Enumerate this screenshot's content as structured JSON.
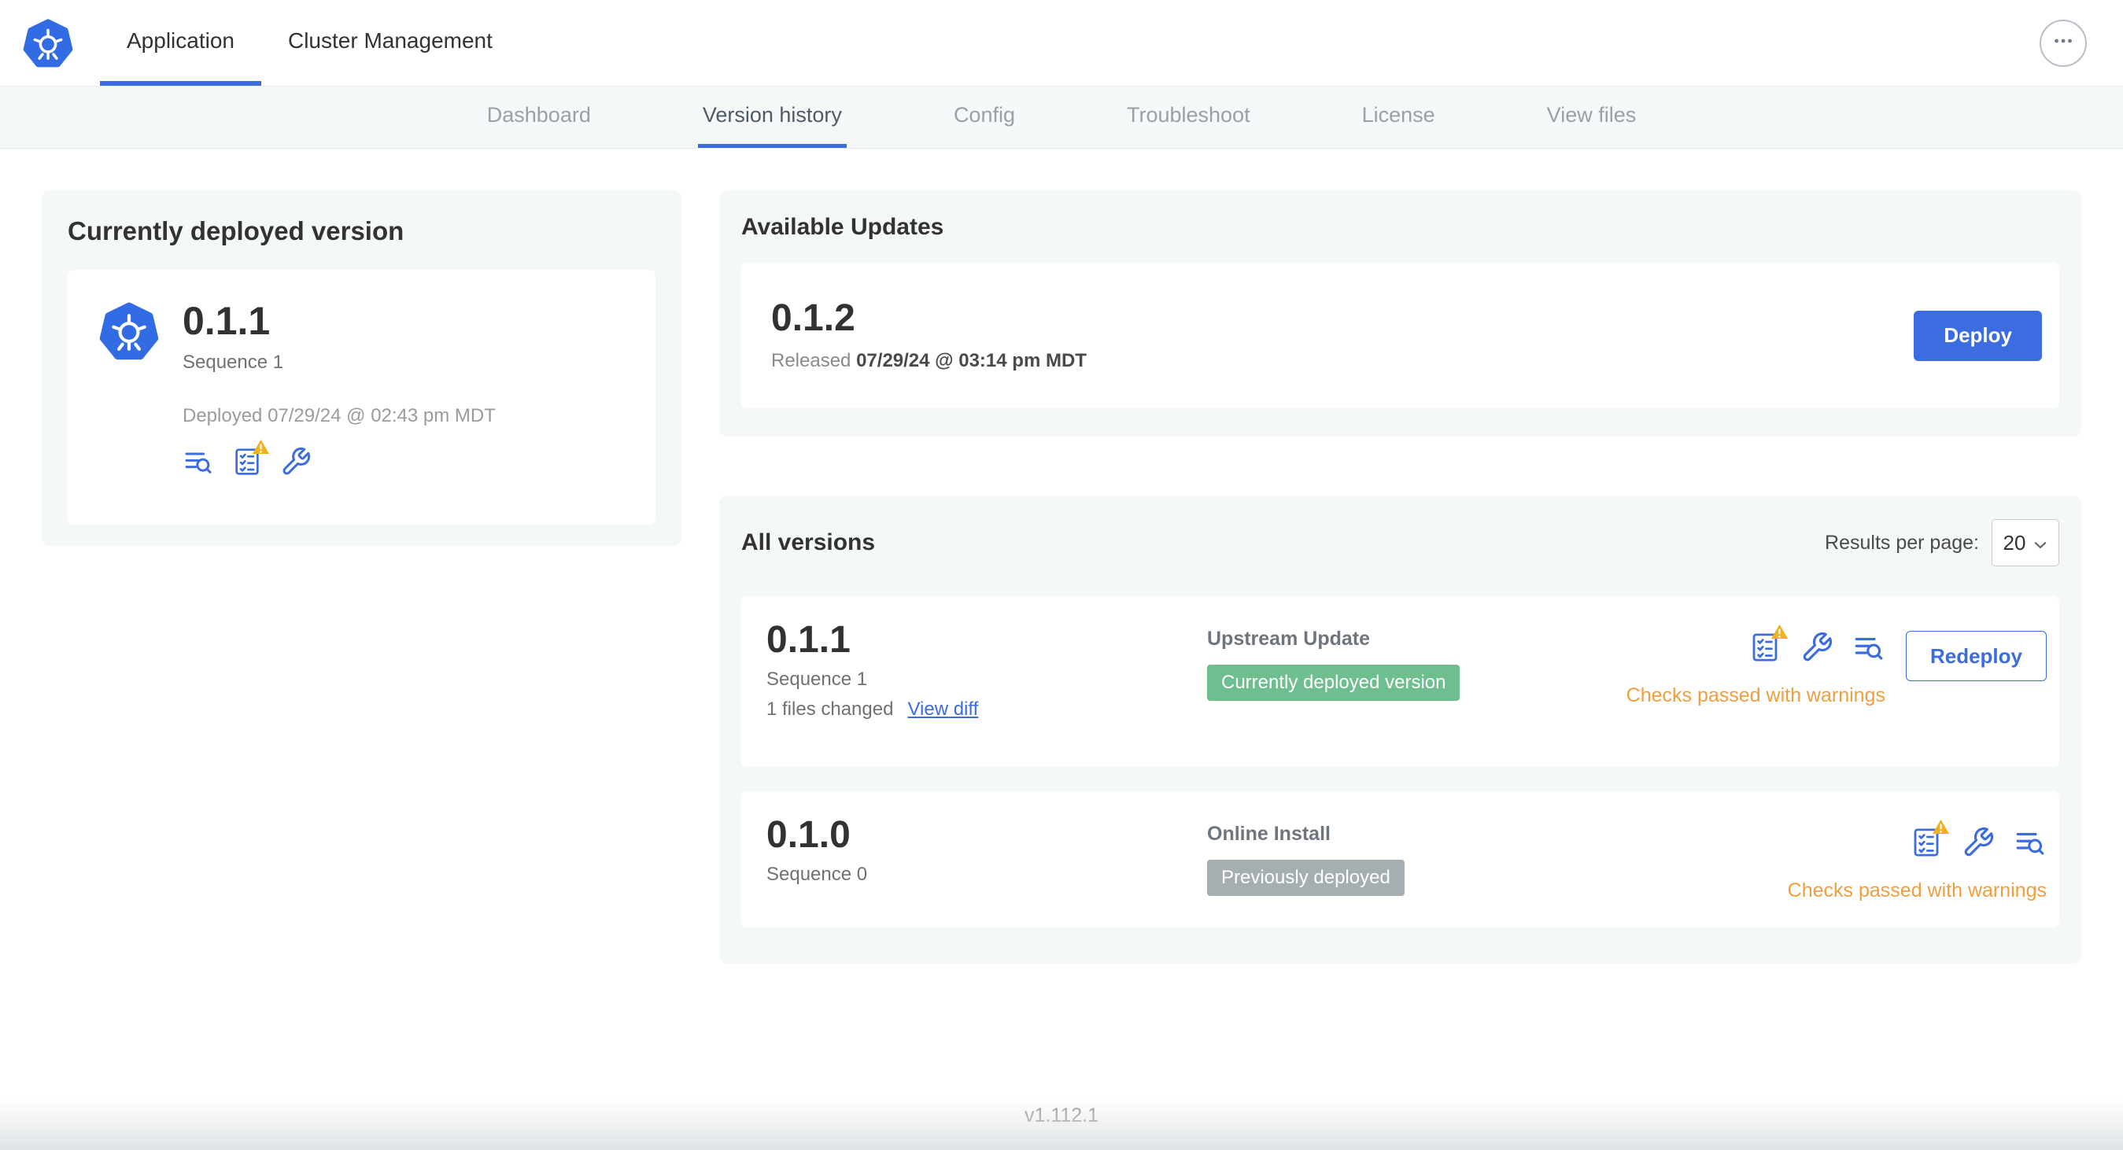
{
  "colors": {
    "accent_blue": "#3b6ce0",
    "kubernetes_blue": "#326ce5",
    "warning_text": "#ef9f3e",
    "warning_triangle": "#f2b01e",
    "badge_green": "#6fbe90",
    "badge_gray": "#a5aeb0"
  },
  "header": {
    "tabs": [
      {
        "label": "Application"
      },
      {
        "label": "Cluster Management"
      }
    ]
  },
  "subnav": {
    "items": [
      "Dashboard",
      "Version history",
      "Config",
      "Troubleshoot",
      "License",
      "View files"
    ],
    "active": "Version history"
  },
  "current_version_card": {
    "title": "Currently deployed version",
    "version": "0.1.1",
    "sequence": "Sequence 1",
    "deployed": "Deployed 07/29/24 @ 02:43 pm MDT"
  },
  "available_updates_card": {
    "title": "Available Updates",
    "version": "0.1.2",
    "released_label": "Released",
    "released_date": "07/29/24 @ 03:14 pm MDT",
    "deploy_button": "Deploy"
  },
  "all_versions_card": {
    "title": "All versions",
    "results_per_page_label": "Results per page:",
    "results_per_page_value": "20",
    "rows": [
      {
        "version": "0.1.1",
        "sequence": "Sequence 1",
        "files_changed": "1 files changed",
        "view_diff_link": "View diff",
        "source": "Upstream Update",
        "badge": "Currently deployed version",
        "badge_color": "#6fbe90",
        "status": "Checks passed with warnings",
        "action_button": "Redeploy"
      },
      {
        "version": "0.1.0",
        "sequence": "Sequence 0",
        "source": "Online Install",
        "badge": "Previously deployed",
        "badge_color": "#a5aeb0",
        "status": "Checks passed with warnings"
      }
    ]
  },
  "footer": {
    "app_version": "v1.112.1"
  }
}
